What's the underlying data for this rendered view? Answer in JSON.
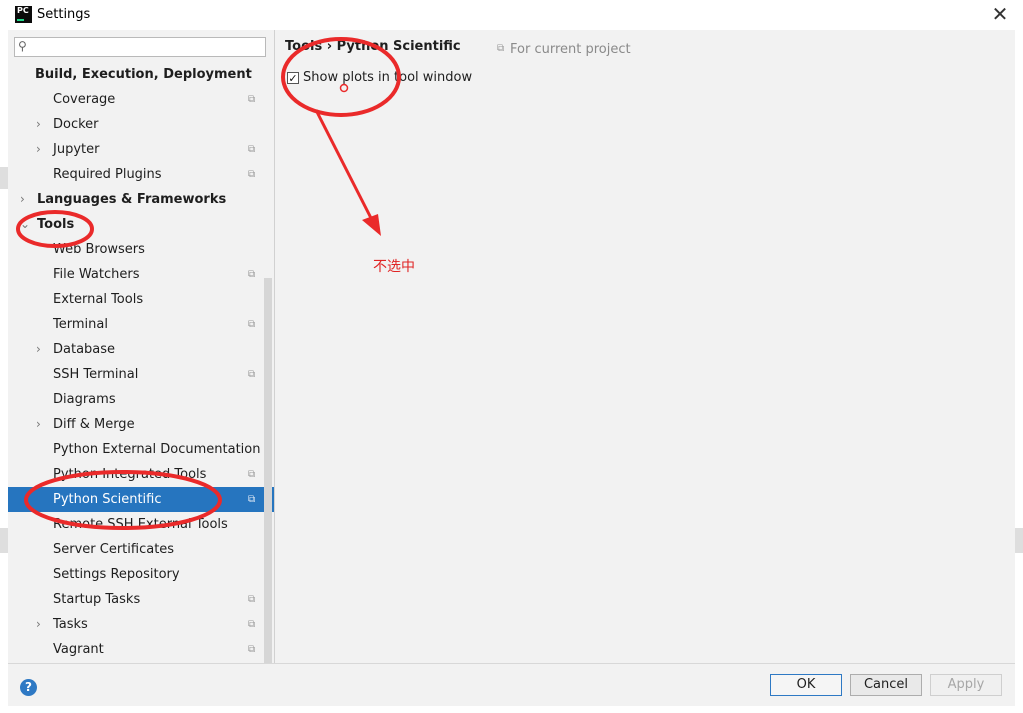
{
  "window": {
    "title": "Settings",
    "logo_text": "PC"
  },
  "search": {
    "placeholder": ""
  },
  "sidebar": {
    "items": [
      {
        "label": "Build, Execution, Deployment"
      },
      {
        "label": "Coverage"
      },
      {
        "label": "Docker"
      },
      {
        "label": "Jupyter"
      },
      {
        "label": "Required Plugins"
      },
      {
        "label": "Languages & Frameworks"
      },
      {
        "label": "Tools"
      },
      {
        "label": "Web Browsers"
      },
      {
        "label": "File Watchers"
      },
      {
        "label": "External Tools"
      },
      {
        "label": "Terminal"
      },
      {
        "label": "Database"
      },
      {
        "label": "SSH Terminal"
      },
      {
        "label": "Diagrams"
      },
      {
        "label": "Diff & Merge"
      },
      {
        "label": "Python External Documentation"
      },
      {
        "label": "Python Integrated Tools"
      },
      {
        "label": "Python Scientific"
      },
      {
        "label": "Remote SSH External Tools"
      },
      {
        "label": "Server Certificates"
      },
      {
        "label": "Settings Repository"
      },
      {
        "label": "Startup Tasks"
      },
      {
        "label": "Tasks"
      },
      {
        "label": "Vagrant"
      }
    ]
  },
  "content": {
    "breadcrumb": "Tools › Python Scientific",
    "scope_label": "For current project",
    "checkbox_label": "Show plots in tool window",
    "checkbox_checked": true
  },
  "annotation": {
    "text": "不选中",
    "color": "#e02424"
  },
  "footer": {
    "ok": "OK",
    "cancel": "Cancel",
    "apply": "Apply",
    "help": "?"
  },
  "colors": {
    "selection": "#2675bf",
    "panel": "#f2f2f2",
    "accent": "#2e79c4"
  }
}
